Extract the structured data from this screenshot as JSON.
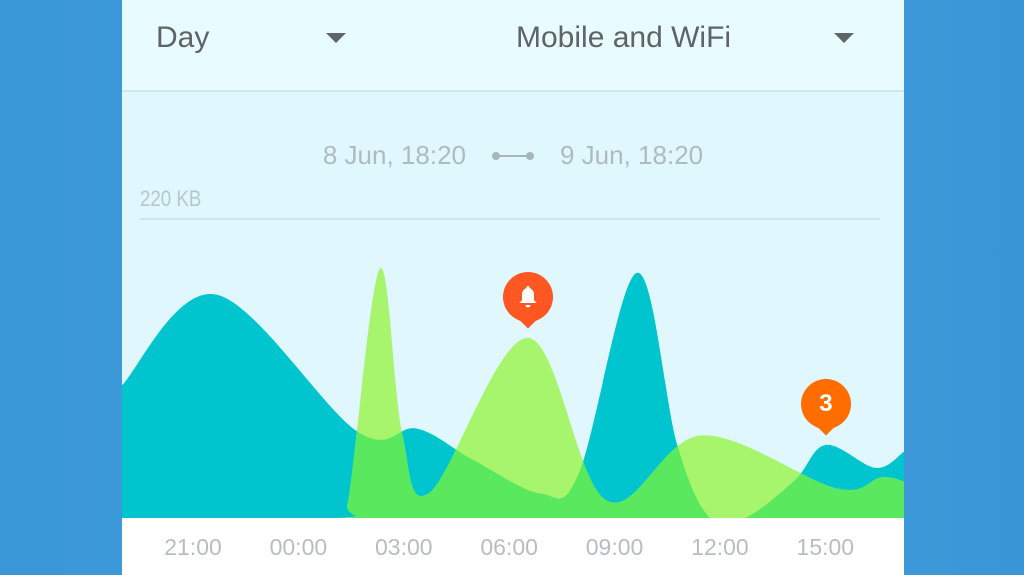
{
  "filters": {
    "period": {
      "value": "Day"
    },
    "network": {
      "value": "Mobile and WiFi"
    }
  },
  "range": {
    "start": "8 Jun, 18:20",
    "end": "9 Jun, 18:20",
    "icon": "range-connector-icon"
  },
  "colors": {
    "series_a": "#00c5cf",
    "series_b": "#a6f56c",
    "overlap": "#5ae85f",
    "alert": "#ff5722",
    "count": "#ff6d00"
  },
  "chart_data": {
    "type": "area",
    "ylabel_max": "220 KB",
    "ylim": [
      0,
      220
    ],
    "x_ticks": [
      "21:00",
      "00:00",
      "03:00",
      "06:00",
      "09:00",
      "12:00",
      "15:00"
    ],
    "series": [
      {
        "color": "#00c5cf",
        "points": [
          [
            "18:59",
            98
          ],
          [
            "21:39",
            165
          ],
          [
            "01:40",
            64
          ],
          [
            "03:23",
            66
          ],
          [
            "04:58",
            43
          ],
          [
            "06:54",
            18
          ],
          [
            "07:59",
            33
          ],
          [
            "09:38",
            181
          ],
          [
            "10:47",
            54
          ],
          [
            "11:43",
            0
          ],
          [
            "12:43",
            0
          ],
          [
            "14:08",
            28
          ],
          [
            "15:01",
            54
          ],
          [
            "16:26",
            37
          ],
          [
            "17:14",
            49
          ]
        ]
      },
      {
        "color": "#a6f56c",
        "points": [
          [
            "18:59",
            0
          ],
          [
            "01:06",
            0
          ],
          [
            "01:25",
            12
          ],
          [
            "02:19",
            184
          ],
          [
            "02:57",
            63
          ],
          [
            "03:45",
            19
          ],
          [
            "06:32",
            133
          ],
          [
            "08:46",
            13
          ],
          [
            "11:29",
            61
          ],
          [
            "15:18",
            22
          ],
          [
            "16:35",
            30
          ],
          [
            "17:14",
            27
          ]
        ]
      }
    ],
    "annotations": [
      {
        "time": "06:32",
        "icon": "bell-icon",
        "label": "",
        "color": "#ff5722"
      },
      {
        "time": "15:01",
        "icon": "",
        "label": "3",
        "color": "#ff6d00"
      }
    ]
  }
}
